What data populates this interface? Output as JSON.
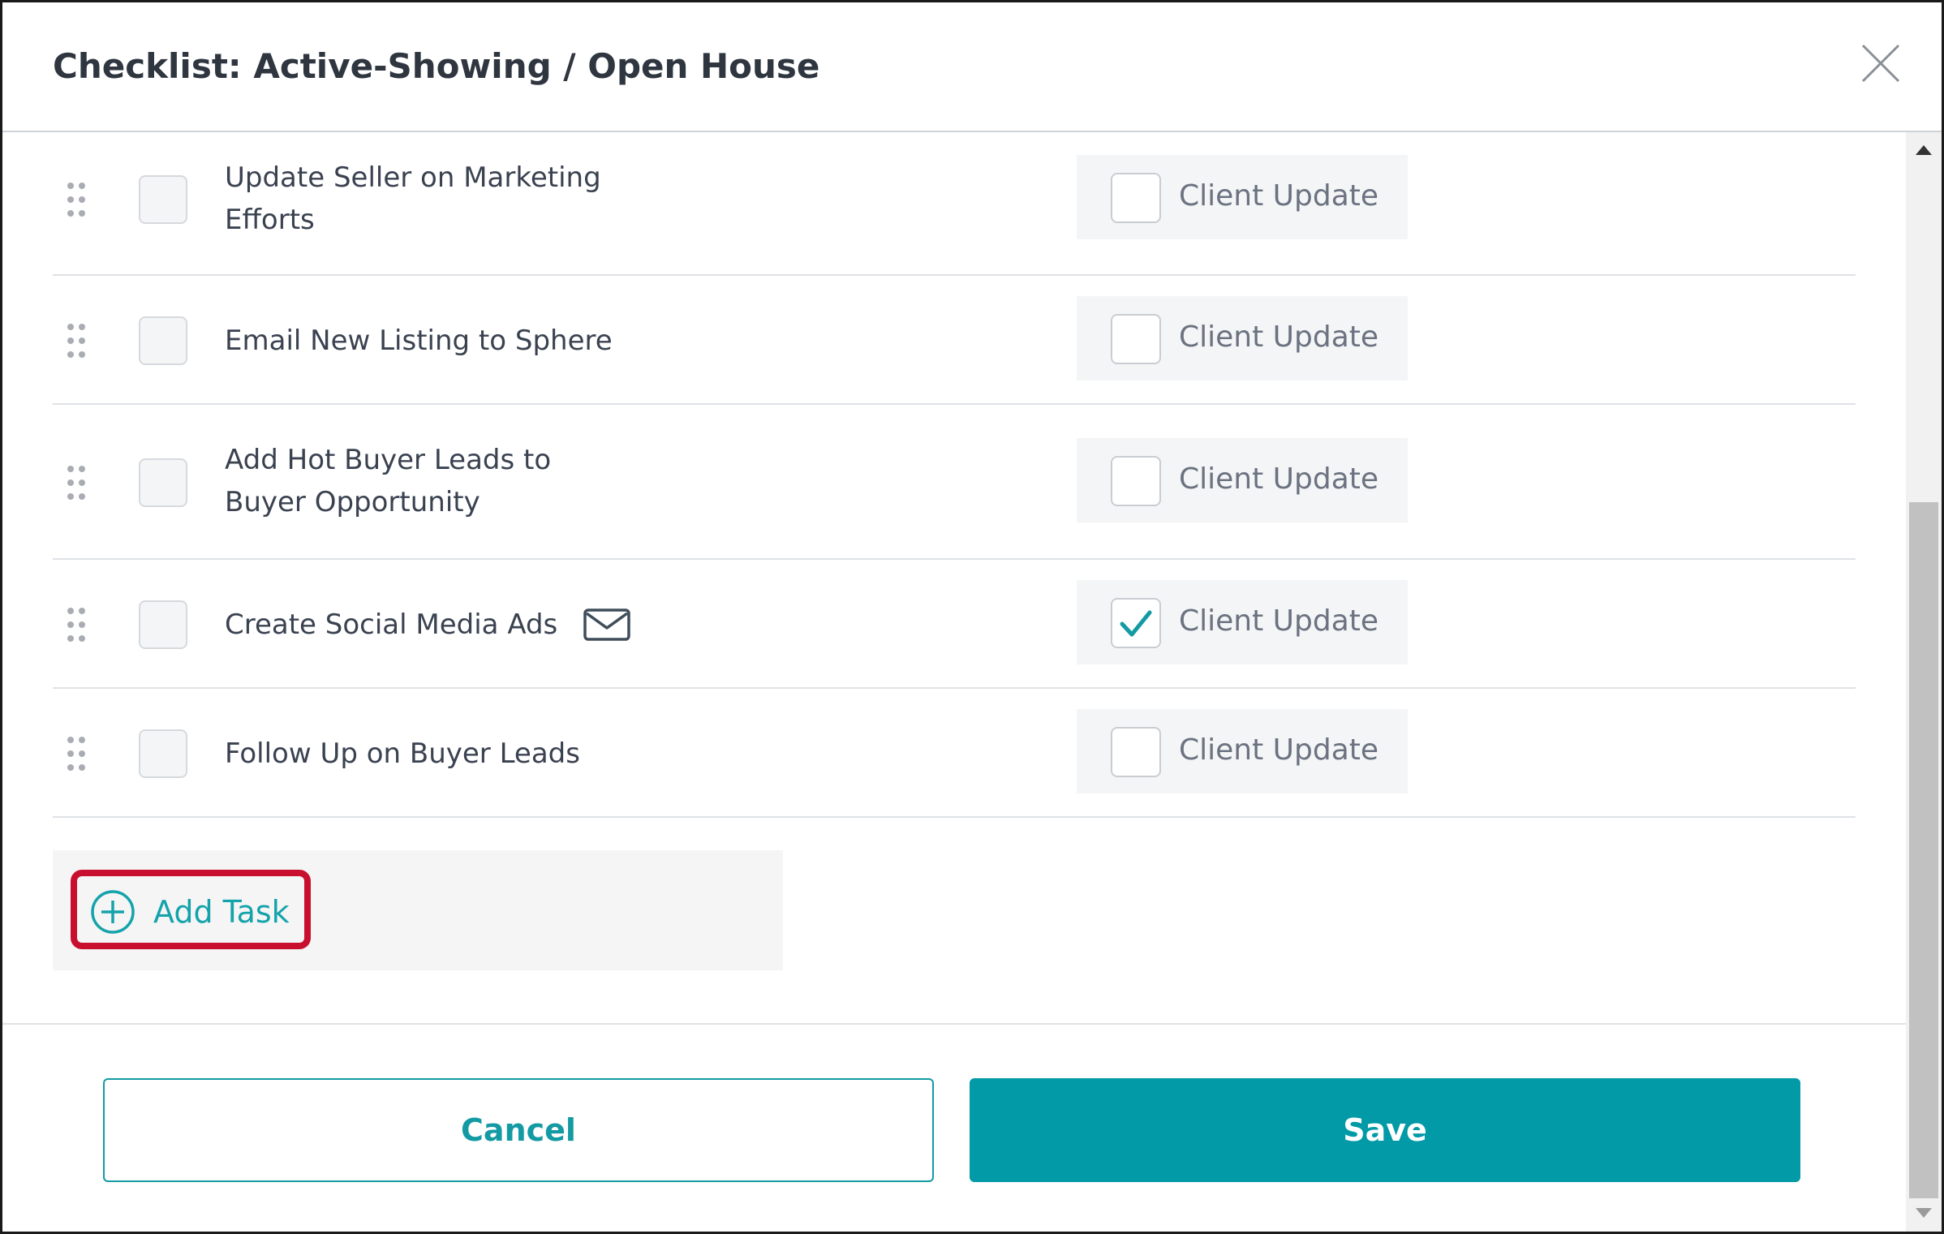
{
  "dialog": {
    "title": "Checklist: Active-Showing / Open House",
    "close_icon": "close-x-icon"
  },
  "tasks": [
    {
      "lines": [
        "Update Seller on Marketing",
        "Efforts"
      ],
      "completed": false,
      "client_update_label": "Client Update",
      "client_update_checked": false,
      "has_email_icon": false
    },
    {
      "lines": [
        "Email New Listing to Sphere"
      ],
      "completed": false,
      "client_update_label": "Client Update",
      "client_update_checked": false,
      "has_email_icon": false
    },
    {
      "lines": [
        "Add Hot Buyer Leads to",
        "Buyer Opportunity"
      ],
      "completed": false,
      "client_update_label": "Client Update",
      "client_update_checked": false,
      "has_email_icon": false
    },
    {
      "lines": [
        "Create Social Media Ads"
      ],
      "completed": false,
      "client_update_label": "Client Update",
      "client_update_checked": true,
      "has_email_icon": true
    },
    {
      "lines": [
        "Follow Up on Buyer Leads"
      ],
      "completed": false,
      "client_update_label": "Client Update",
      "client_update_checked": false,
      "has_email_icon": false
    }
  ],
  "add_task": {
    "label": "Add Task",
    "icon": "plus-circle-icon"
  },
  "footer": {
    "cancel_label": "Cancel",
    "save_label": "Save"
  },
  "colors": {
    "accent": "#029aa6",
    "highlight": "#c8102e",
    "title_text": "#2f3640"
  }
}
